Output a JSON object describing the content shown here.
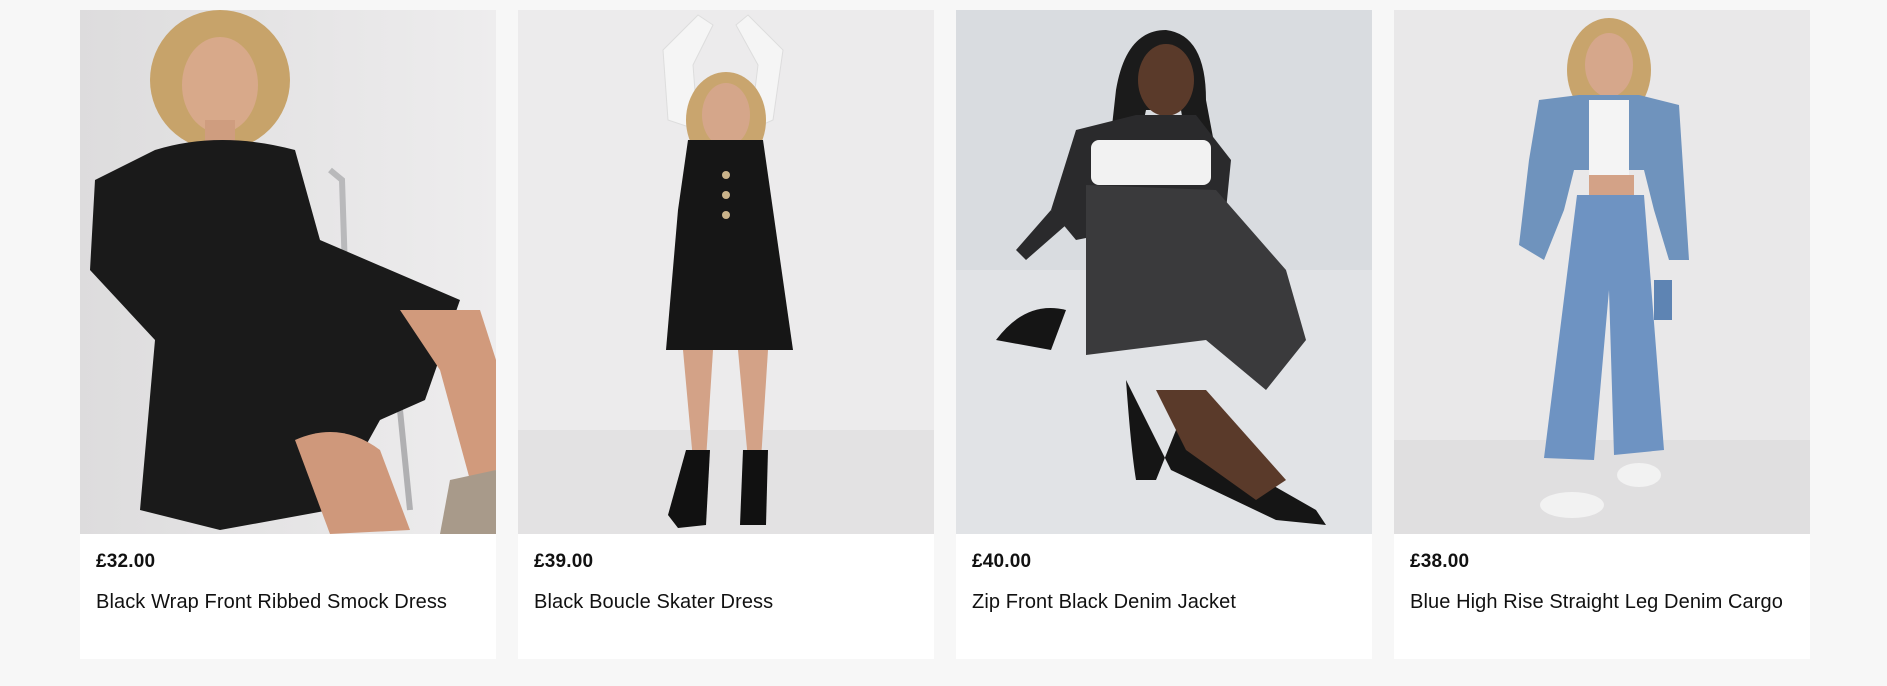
{
  "products": [
    {
      "price": "£32.00",
      "name": "Black Wrap Front Ribbed Smock Dress",
      "image": "woman-black-smock-dress-photo"
    },
    {
      "price": "£39.00",
      "name": "Black Boucle Skater Dress",
      "image": "woman-black-pinafore-dress-photo"
    },
    {
      "price": "£40.00",
      "name": "Zip Front Black Denim Jacket",
      "image": "woman-black-denim-jacket-photo"
    },
    {
      "price": "£38.00",
      "name": "Blue High Rise Straight Leg Denim Cargo",
      "image": "woman-blue-denim-cargo-photo"
    }
  ],
  "colors": {
    "page_background": "#f7f7f7",
    "card_background": "#ffffff",
    "text": "#111111"
  }
}
